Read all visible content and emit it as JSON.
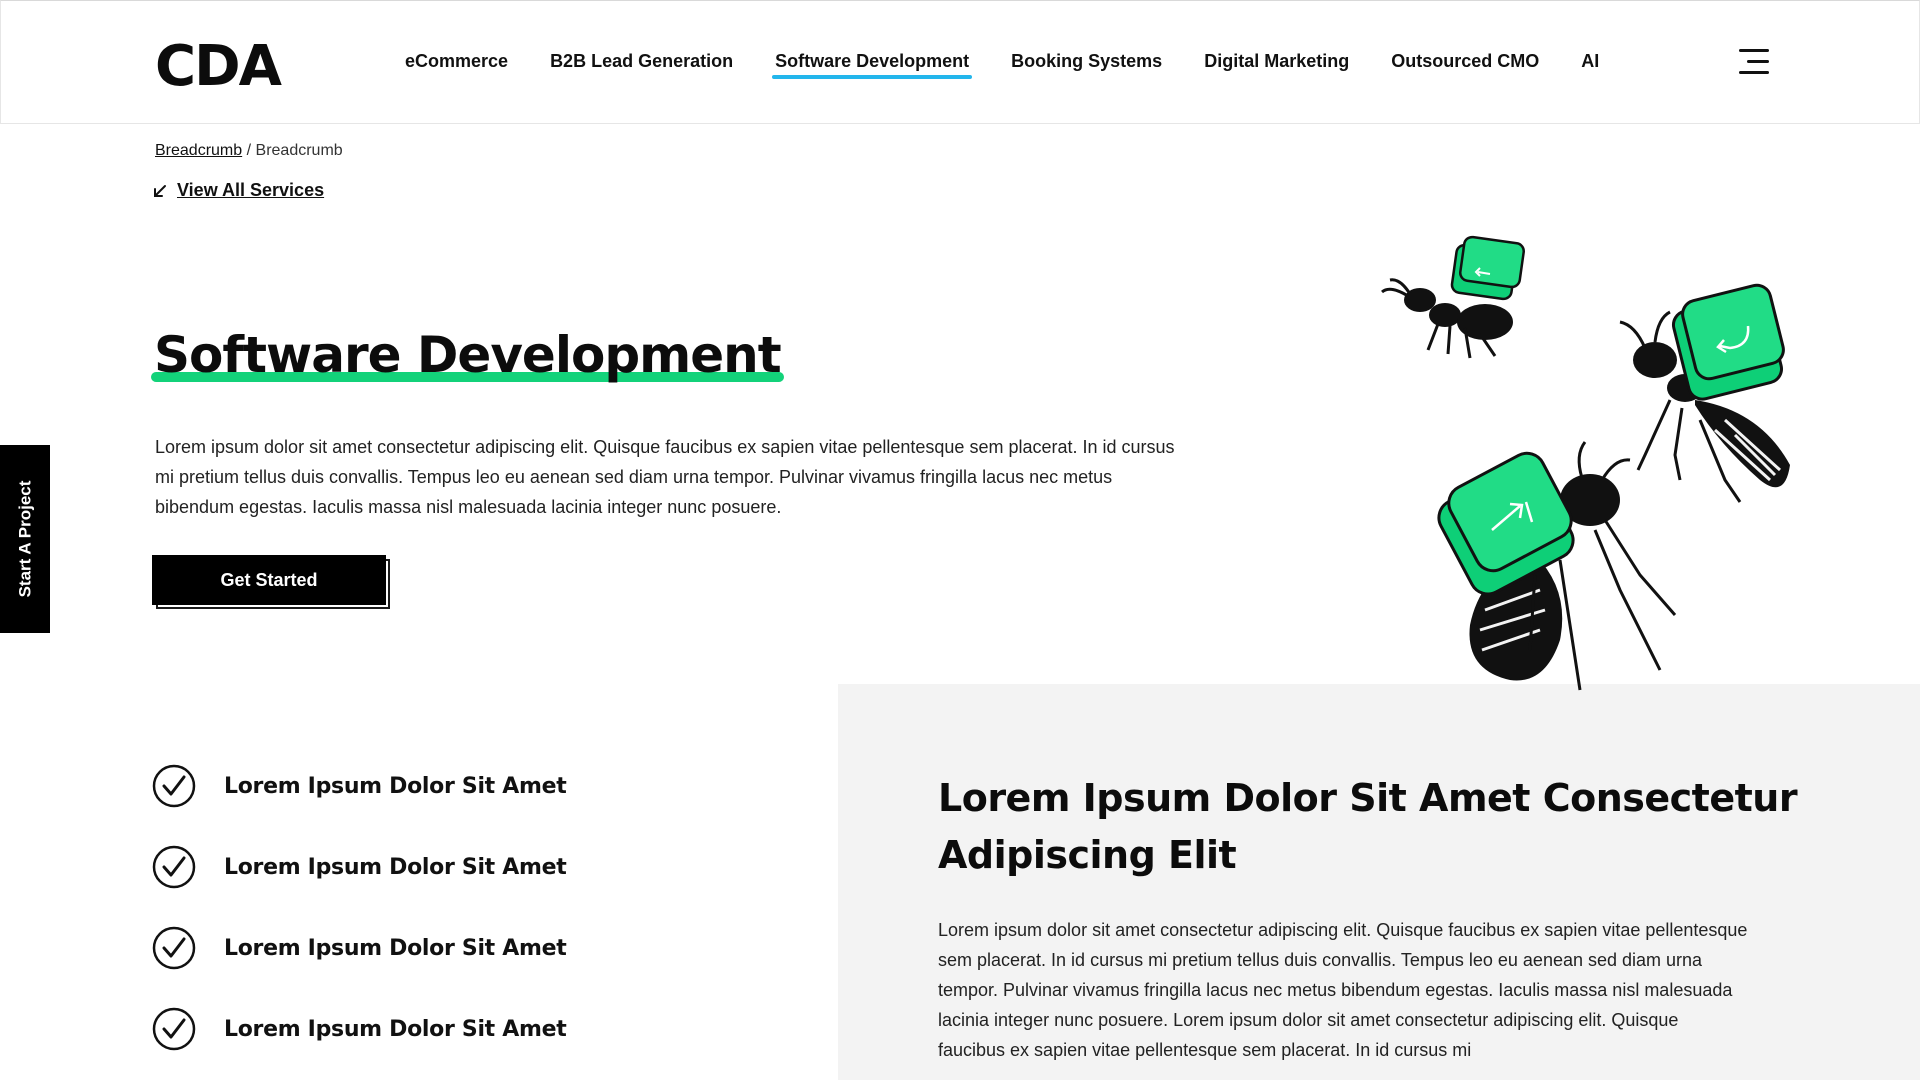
{
  "header": {
    "logo_text": "CDA",
    "nav": [
      {
        "label": "eCommerce"
      },
      {
        "label": "B2B Lead Generation"
      },
      {
        "label": "Software Development",
        "active": true
      },
      {
        "label": "Booking Systems"
      },
      {
        "label": "Digital Marketing"
      },
      {
        "label": "Outsourced CMO"
      },
      {
        "label": "AI"
      }
    ],
    "menu_icon": "hamburger-menu-icon"
  },
  "breadcrumb": {
    "link": "Breadcrumb",
    "separator": "/",
    "current": "Breadcrumb"
  },
  "view_all": {
    "icon": "arrow-down-left-icon",
    "label": "View All Services"
  },
  "hero": {
    "title": "Software Development",
    "text": "Lorem ipsum dolor sit amet consectetur adipiscing elit. Quisque faucibus ex sapien vitae pellentesque sem placerat. In id cursus mi pretium tellus duis convallis. Tempus leo eu aenean sed diam urna tempor. Pulvinar vivamus fringilla lacus nec metus bibendum egestas. Iaculis massa nisl malesuada lacinia integer nunc posuere.",
    "cta_label": "Get Started"
  },
  "side_tab": {
    "label": "Start A Project"
  },
  "checklist": [
    {
      "label": "Lorem Ipsum Dolor Sit Amet"
    },
    {
      "label": "Lorem Ipsum Dolor Sit Amet"
    },
    {
      "label": "Lorem Ipsum Dolor Sit Amet"
    },
    {
      "label": "Lorem Ipsum Dolor Sit Amet"
    }
  ],
  "section": {
    "title": "Lorem Ipsum Dolor Sit Amet Consectetur Adipiscing Elit",
    "text": "Lorem ipsum dolor sit amet consectetur adipiscing elit. Quisque faucibus ex sapien vitae pellentesque sem placerat. In id cursus mi pretium tellus duis convallis. Tempus leo eu aenean sed diam urna tempor. Pulvinar vivamus fringilla lacus nec metus bibendum egestas. Iaculis massa nisl malesuada lacinia integer nunc posuere. Lorem ipsum dolor sit amet consectetur adipiscing elit. Quisque faucibus ex sapien vitae pellentesque sem placerat. In id cursus mi"
  },
  "colors": {
    "accent_green": "#13d27a",
    "active_nav_underline": "#23b6ec",
    "panel_gray": "#f3f3f3",
    "ink": "#0c0c0c"
  }
}
